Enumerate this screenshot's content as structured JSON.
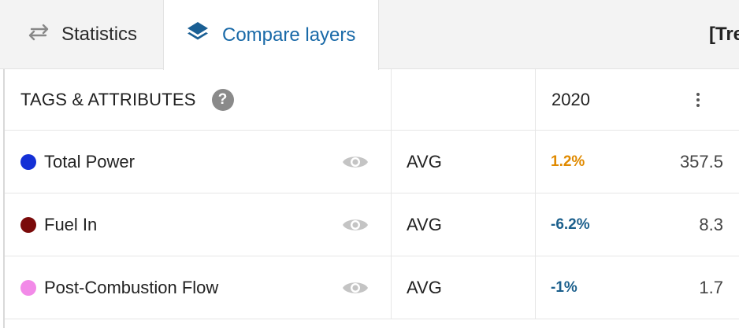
{
  "tabs": {
    "statistics_label": "Statistics",
    "compare_label": "Compare layers",
    "truncated_label": "[Tre"
  },
  "table": {
    "header": {
      "title": "TAGS & ATTRIBUTES",
      "help_symbol": "?",
      "year": "2020"
    },
    "rows": [
      {
        "name": "Total Power",
        "color": "#1430d6",
        "aggregation": "AVG",
        "change": "1.2%",
        "change_color": "#e08a00",
        "value": "357.5"
      },
      {
        "name": "Fuel In",
        "color": "#7a0a0a",
        "aggregation": "AVG",
        "change": "-6.2%",
        "change_color": "#1b5f8c",
        "value": "8.3"
      },
      {
        "name": "Post-Combustion Flow",
        "color": "#f28ae8",
        "aggregation": "AVG",
        "change": "-1%",
        "change_color": "#1b5f8c",
        "value": "1.7"
      }
    ]
  },
  "icons": {
    "statistics_tab": "swap-arrows-icon",
    "compare_tab": "layers-icon",
    "help": "help-icon",
    "visibility": "eye-icon",
    "menu": "more-vertical-icon"
  }
}
